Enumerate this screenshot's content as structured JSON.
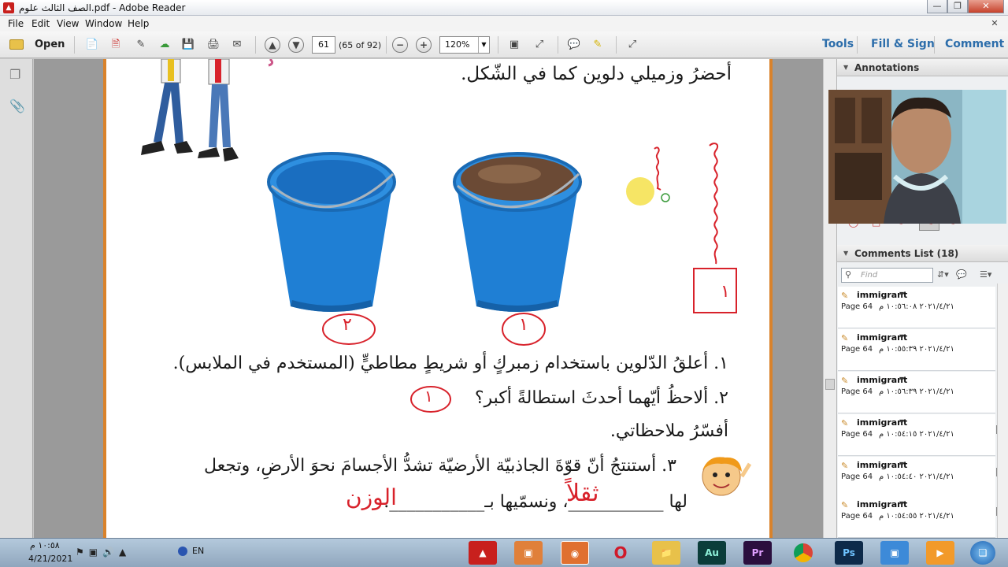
{
  "window": {
    "title": "الصف الثالث علوم.pdf - Adobe Reader"
  },
  "menu": {
    "items": [
      "File",
      "Edit",
      "View",
      "Window",
      "Help"
    ]
  },
  "toolbar": {
    "open_label": "Open",
    "page_number": "61",
    "page_count": "(65 of 92)",
    "zoom": "120%",
    "tools_label": "Tools",
    "fill_sign_label": "Fill & Sign",
    "comment_label": "Comment"
  },
  "document": {
    "line_bullet1": "أحضرُ وزميلي دلوين كما في الشّكل.",
    "step1": "١. أعلقُ الدّلوين باستخدام زمبركٍ أو شريطٍ مطاطيٍّ (المستخدم في الملابس).",
    "step2": "٢. ألاحظُ أيّهما أحدثَ استطالةً أكبر؟",
    "bullet2": "أفسّرُ ملاحظاتي.",
    "step3": "٣. أستنتجُ أنّ قوّةَ الجاذبيّة الأرضيّة تشدُّ الأجسامَ نحوَ الأرضِ، وتجعل",
    "step3b": "لها ___________، ونسمّيها بـ___________.",
    "hand_answer_step2": "١",
    "hand_bucket1": "١",
    "hand_bucket2": "٢",
    "hand_box": "١",
    "hand_fill1": "ثقلاً",
    "hand_fill2": "الوزن"
  },
  "right_panel": {
    "annotations_title": "Annotations",
    "comments_title": "Comments List (18)",
    "find_placeholder": "Find",
    "comments": [
      {
        "author": "immigrant",
        "page": "Page 64",
        "time": "٢٠٢١/٤/٢١ ١٠:٥٦:٠٨ م"
      },
      {
        "author": "immigrant",
        "page": "Page 64",
        "time": "٢٠٢١/٤/٢١ ١٠:٥٥:٣٩ م"
      },
      {
        "author": "immigrant",
        "page": "Page 64",
        "time": "٢٠٢١/٤/٢١ ١٠:٥٦:٣٩ م"
      },
      {
        "author": "immigrant",
        "page": "Page 64",
        "time": "٢٠٢١/٤/٢١ ١٠:٥٤:١٥ م"
      },
      {
        "author": "immigrant",
        "page": "Page 64",
        "time": "٢٠٢١/٤/٢١ ١٠:٥٤:٤٠ م"
      },
      {
        "author": "immigrant",
        "page": "Page 64",
        "time": "٢٠٢١/٤/٢١ ١٠:٥٤:٥٥ م"
      }
    ]
  },
  "taskbar": {
    "clock_time": "١٠:٥٨ م",
    "clock_date": "4/21/2021",
    "lang": "EN",
    "apps": [
      "Adobe Reader",
      "Screenshot",
      "Screen Recorder",
      "Opera",
      "File Explorer",
      "Au",
      "Pr",
      "Chrome",
      "Ps",
      "Image Viewer",
      "Media"
    ]
  },
  "colors": {
    "accent": "#2d6eab",
    "page_border": "#d9822b",
    "ink": "#d8222b",
    "bucket": "#1f7fd4"
  }
}
